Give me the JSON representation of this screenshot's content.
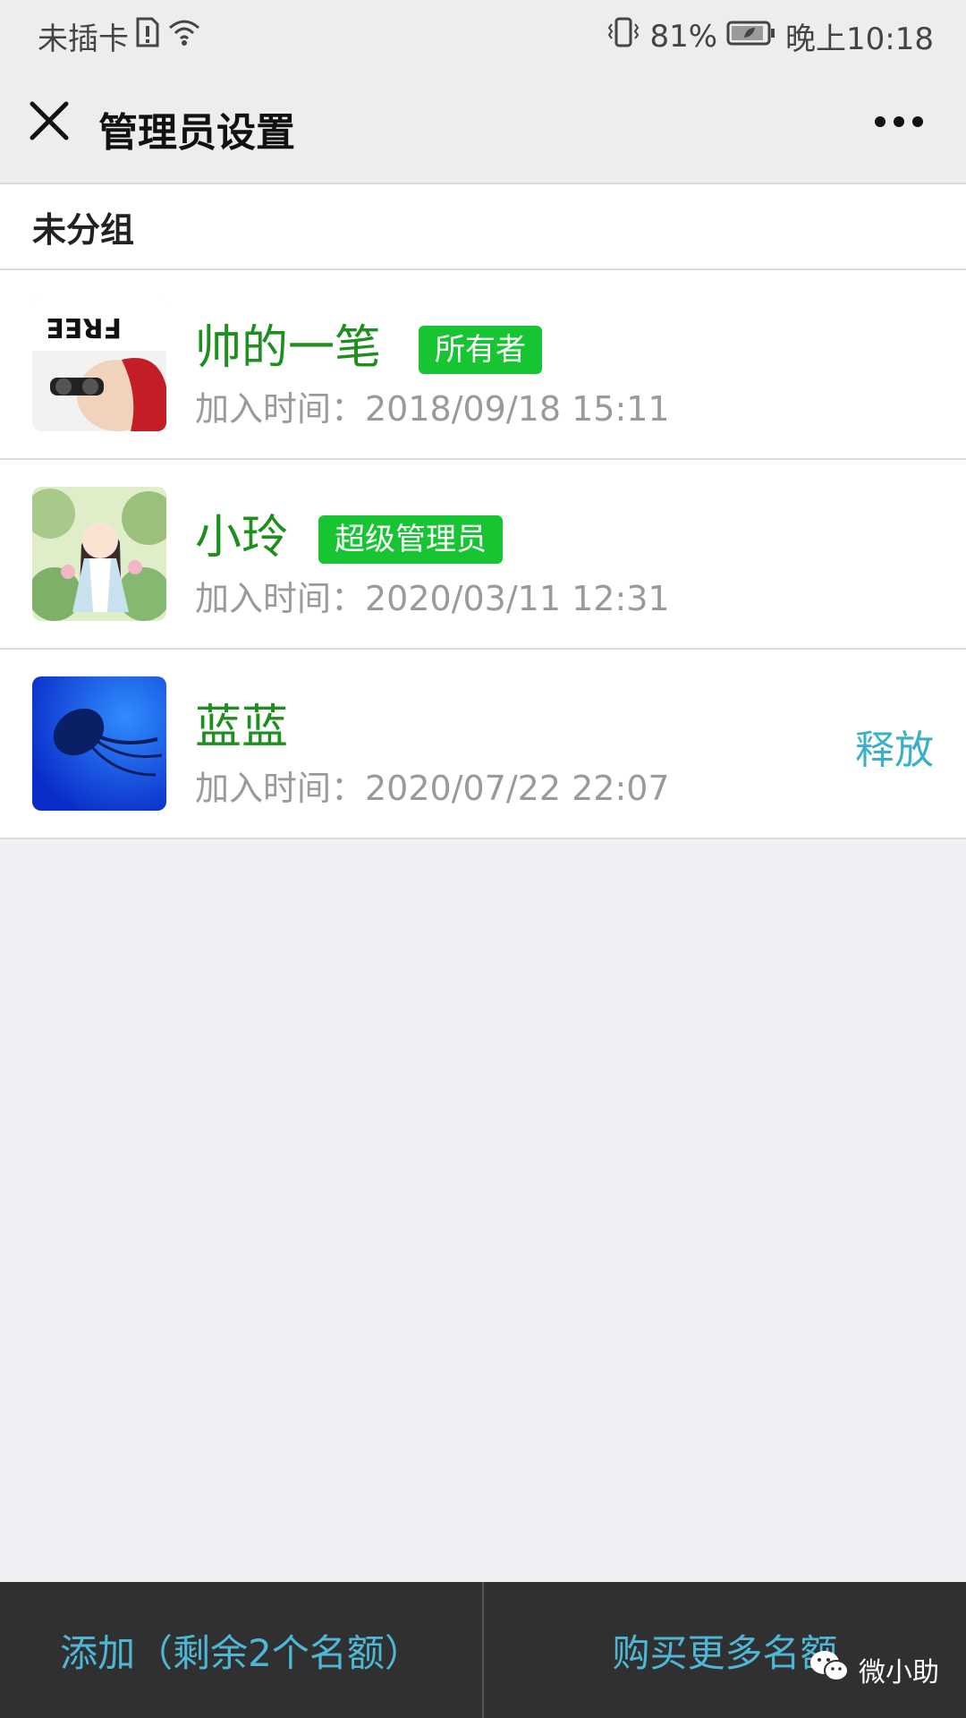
{
  "status_bar": {
    "carrier": "未插卡",
    "battery_percent": "81%",
    "time": "晚上10:18"
  },
  "header": {
    "title": "管理员设置"
  },
  "group": {
    "title": "未分组"
  },
  "members": [
    {
      "name": "帅的一笔",
      "badge": "所有者",
      "join_time": "加入时间：2018/09/18 15:11",
      "avatar_text": "FREE"
    },
    {
      "name": "小玲",
      "badge": "超级管理员",
      "join_time": "加入时间：2020/03/11 12:31"
    },
    {
      "name": "蓝蓝",
      "join_time": "加入时间：2020/07/22 22:07",
      "action": "释放"
    }
  ],
  "bottom_bar": {
    "add_label": "添加（剩余2个名额）",
    "buy_label": "购买更多名额",
    "watermark": "微小助"
  },
  "colors": {
    "name_green": "#1e8f1e",
    "badge_green": "#17c532",
    "link_blue": "#3ab0c8"
  }
}
